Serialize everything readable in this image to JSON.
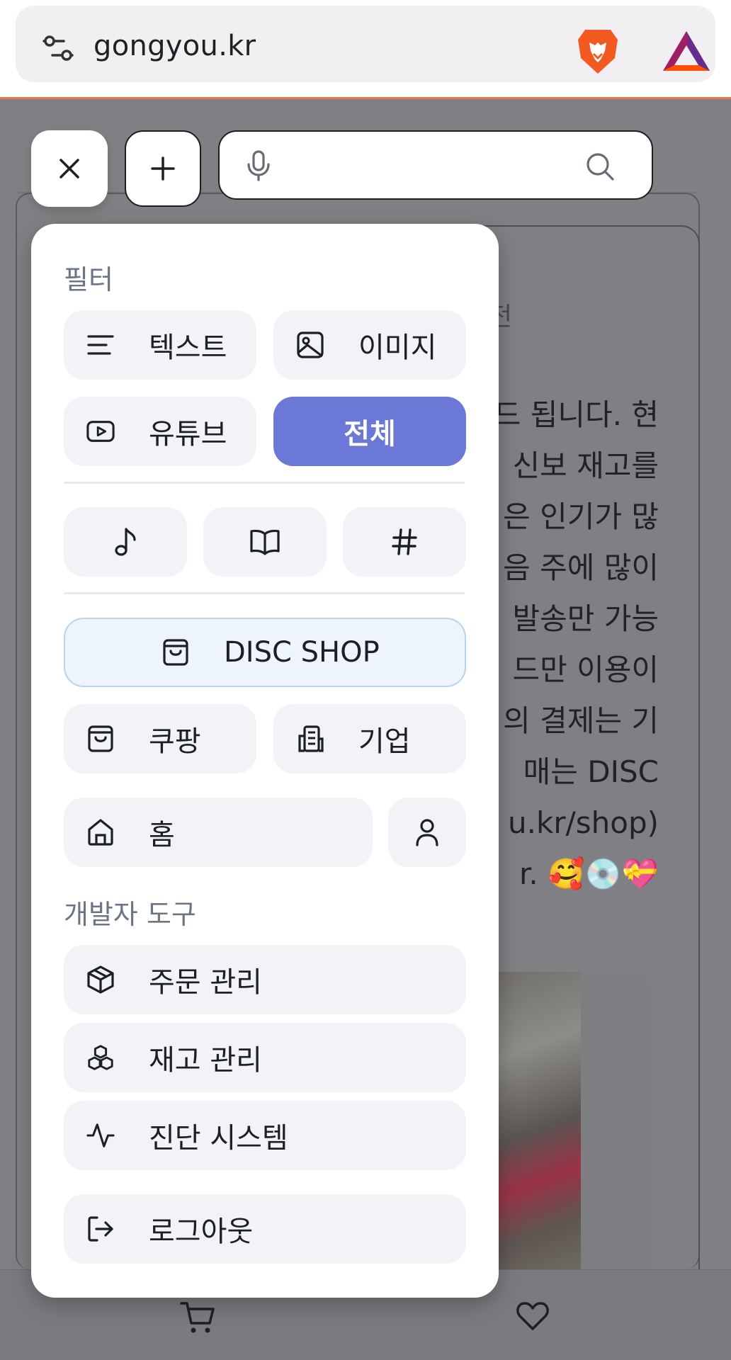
{
  "browser": {
    "url": "gongyou.kr",
    "icons": [
      "tune-icon",
      "brave-lion-icon",
      "bat-triangle-icon"
    ],
    "accent_color": "#e8764a"
  },
  "background_page": {
    "time_label": "전",
    "text_lines": [
      "드 됩니다. 현",
      "신보 재고를",
      "은 인기가 많",
      "음 주에 많이",
      "발송만 가능",
      "드만 이용이",
      "의 결제는 기",
      "매는 DISC",
      "u.kr/shop)",
      "r. 🥰💿💝"
    ]
  },
  "top_controls": {
    "close_icon": "close-icon",
    "add_icon": "plus-icon",
    "search_placeholder": ""
  },
  "menu": {
    "filter_title": "필터",
    "filters": {
      "text": "텍스트",
      "image": "이미지",
      "youtube": "유튜브",
      "all": "전체"
    },
    "active_color": "#6b78d6",
    "icon_row": [
      "music-note-icon",
      "book-open-icon",
      "hash-icon"
    ],
    "disc_shop": "DISC SHOP",
    "coupang": "쿠팡",
    "company": "기업",
    "home": "홈",
    "dev_tools_title": "개발자 도구",
    "orders": "주문 관리",
    "inventory": "재고 관리",
    "diagnostics": "진단 시스템",
    "logout": "로그아웃"
  },
  "bottom_nav": {
    "icons": [
      "cart-icon",
      "heart-icon"
    ]
  }
}
